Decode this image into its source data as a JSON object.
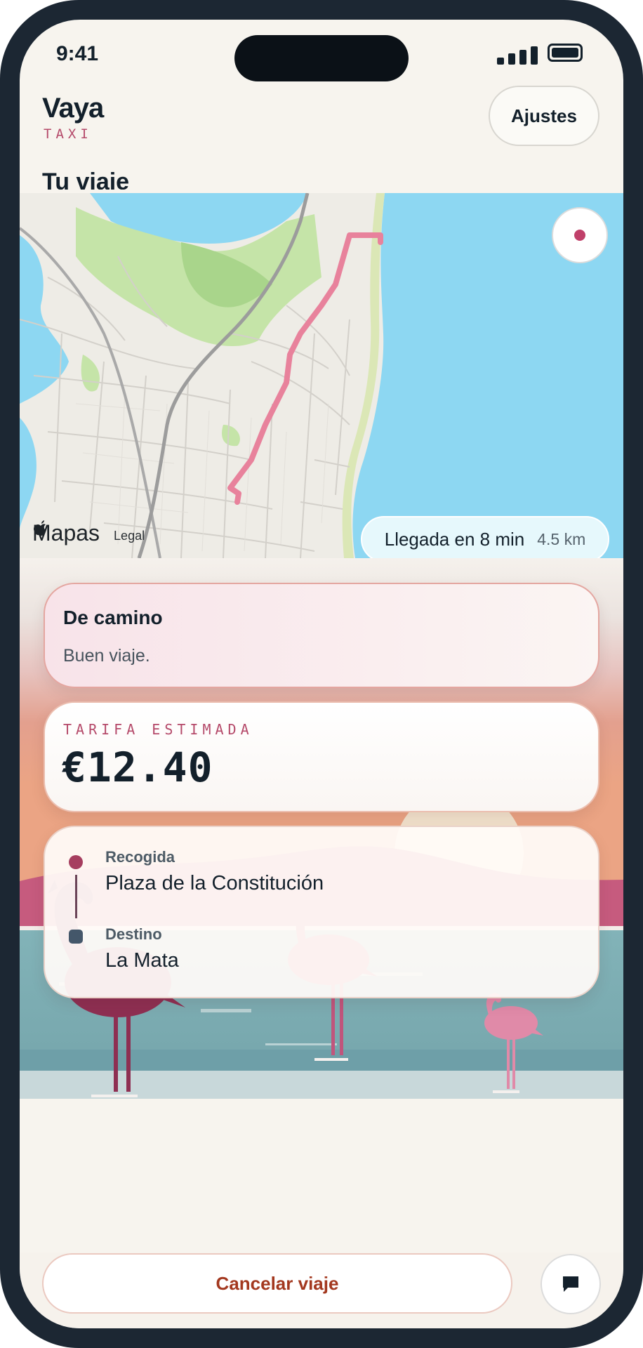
{
  "status_bar": {
    "time": "9:41"
  },
  "header": {
    "brand": "Vaya",
    "brand_sub": "TAXI",
    "settings_label": "Ajustes",
    "section_title": "Tu viaje"
  },
  "map": {
    "attribution_brand": "Mapas",
    "attribution_legal": "Legal",
    "eta_text": "Llegada en 8 min",
    "eta_distance": "4.5 km",
    "route_color": "#e8829c",
    "water_color": "#8dd7f2",
    "park_color": "#c5e4a8"
  },
  "status_card": {
    "title": "De camino",
    "subtitle": "Buen viaje."
  },
  "fare_card": {
    "label": "TARIFA ESTIMADA",
    "value": "€12.40"
  },
  "route_card": {
    "pickup_label": "Recogida",
    "pickup_value": "Plaza de la Constitución",
    "destination_label": "Destino",
    "destination_value": "La Mata"
  },
  "actions": {
    "cancel_label": "Cancelar viaje",
    "chat_icon": "chat-bubble-icon"
  },
  "colors": {
    "accent": "#b54a6a",
    "danger": "#a3381f",
    "ink": "#13202b"
  }
}
